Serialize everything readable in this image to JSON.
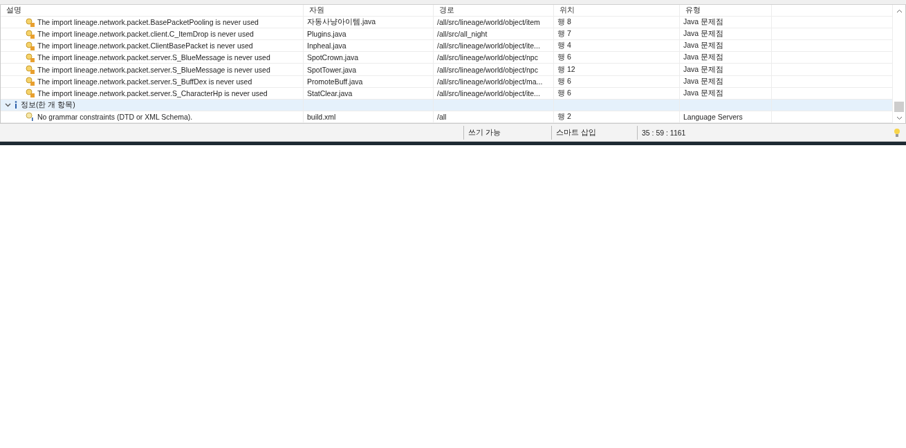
{
  "table": {
    "columns": [
      "설명",
      "자원",
      "경로",
      "위치",
      "유형"
    ],
    "rows": [
      {
        "kind": "warning",
        "description": "The import lineage.network.packet.BasePacketPooling is never used",
        "resource": "자동사냥아이템.java",
        "path": "/all/src/lineage/world/object/item",
        "location": "행 8",
        "type": "Java 문제점"
      },
      {
        "kind": "warning",
        "description": "The import lineage.network.packet.client.C_ItemDrop is never used",
        "resource": "Plugins.java",
        "path": "/all/src/all_night",
        "location": "행 7",
        "type": "Java 문제점"
      },
      {
        "kind": "warning",
        "description": "The import lineage.network.packet.ClientBasePacket is never used",
        "resource": "Inpheal.java",
        "path": "/all/src/lineage/world/object/ite...",
        "location": "행 4",
        "type": "Java 문제점"
      },
      {
        "kind": "warning",
        "description": "The import lineage.network.packet.server.S_BlueMessage is never used",
        "resource": "SpotCrown.java",
        "path": "/all/src/lineage/world/object/npc",
        "location": "행 6",
        "type": "Java 문제점"
      },
      {
        "kind": "warning",
        "description": "The import lineage.network.packet.server.S_BlueMessage is never used",
        "resource": "SpotTower.java",
        "path": "/all/src/lineage/world/object/npc",
        "location": "행 12",
        "type": "Java 문제점"
      },
      {
        "kind": "warning",
        "description": "The import lineage.network.packet.server.S_BuffDex is never used",
        "resource": "PromoteBuff.java",
        "path": "/all/src/lineage/world/object/ma...",
        "location": "행 6",
        "type": "Java 문제점"
      },
      {
        "kind": "warning",
        "description": "The import lineage.network.packet.server.S_CharacterHp is never used",
        "resource": "StatClear.java",
        "path": "/all/src/lineage/world/object/ite...",
        "location": "행 6",
        "type": "Java 문제점"
      },
      {
        "kind": "group",
        "label": "정보(한 개 항목)",
        "expanded": true,
        "selected": true
      },
      {
        "kind": "info",
        "description": "No grammar constraints (DTD or XML Schema).",
        "resource": "build.xml",
        "path": "/all",
        "location": "행 2",
        "type": "Language Servers"
      }
    ]
  },
  "status_bar": {
    "mode": "쓰기 가능",
    "insert": "스마트 삽입",
    "position": "35 : 59 : 1161"
  }
}
